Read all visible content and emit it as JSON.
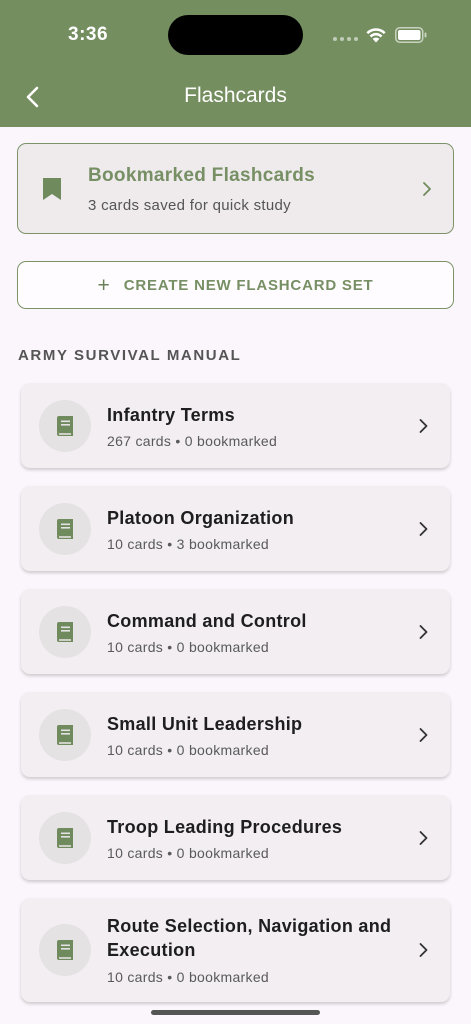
{
  "status_bar": {
    "time": "3:36"
  },
  "nav": {
    "title": "Flashcards",
    "back_icon": "chevron-left-icon"
  },
  "bookmarked": {
    "title": "Bookmarked Flashcards",
    "subtitle": "3 cards saved for quick study",
    "icon": "bookmark-icon"
  },
  "create_button": {
    "plus": "+",
    "label": "CREATE NEW FLASHCARD SET"
  },
  "section": {
    "title": "ARMY SURVIVAL MANUAL"
  },
  "sets": [
    {
      "title": "Infantry Terms",
      "meta": "267 cards • 0 bookmarked"
    },
    {
      "title": "Platoon Organization",
      "meta": "10 cards • 3 bookmarked"
    },
    {
      "title": "Command and Control",
      "meta": "10 cards • 0 bookmarked"
    },
    {
      "title": "Small Unit Leadership",
      "meta": "10 cards • 0 bookmarked"
    },
    {
      "title": "Troop Leading Procedures",
      "meta": "10 cards • 0 bookmarked"
    },
    {
      "title": "Route Selection, Navigation and Execution",
      "meta": "10 cards • 0 bookmarked"
    }
  ],
  "colors": {
    "accent": "#748e60",
    "background": "#fbf6fb",
    "card": "#f2eef2"
  }
}
